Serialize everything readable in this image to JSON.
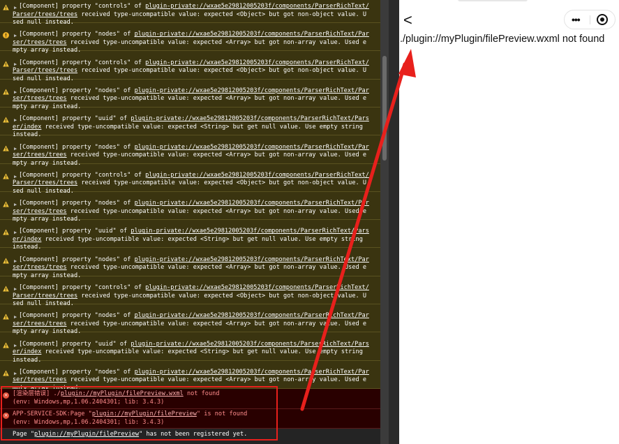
{
  "console": {
    "entries": [
      {
        "type": "warning",
        "first": "[Component] property \"controls\" of ",
        "link": "plugin-private://wxae5e29812005203f/components/ParserRichText/Parser/trees/trees",
        "rest": " received type-uncompatible value: expected <Object> but got non-object value. Used null instead."
      },
      {
        "type": "info",
        "first": "[Component] property \"nodes\" of ",
        "link": "plugin-private://wxae5e29812005203f/components/ParserRichText/Parser/trees/trees",
        "rest": " received type-uncompatible value: expected <Array> but got non-array value. Used empty array instead."
      },
      {
        "type": "warning",
        "first": "[Component] property \"controls\" of ",
        "link": "plugin-private://wxae5e29812005203f/components/ParserRichText/Parser/trees/trees",
        "rest": " received type-uncompatible value: expected <Object> but got non-object value. Used null instead."
      },
      {
        "type": "warning",
        "first": "[Component] property \"nodes\" of ",
        "link": "plugin-private://wxae5e29812005203f/components/ParserRichText/Parser/trees/trees",
        "rest": " received type-uncompatible value: expected <Array> but got non-array value. Used empty array instead."
      },
      {
        "type": "warning",
        "first": "[Component] property \"uuid\" of ",
        "link": "plugin-private://wxae5e29812005203f/components/ParserRichText/Parser/index",
        "rest": " received type-uncompatible value: expected <String> but get null value. Use empty string instead."
      },
      {
        "type": "warning",
        "first": "[Component] property \"nodes\" of ",
        "link": "plugin-private://wxae5e29812005203f/components/ParserRichText/Parser/trees/trees",
        "rest": " received type-uncompatible value: expected <Array> but got non-array value. Used empty array instead."
      },
      {
        "type": "warning",
        "first": "[Component] property \"controls\" of ",
        "link": "plugin-private://wxae5e29812005203f/components/ParserRichText/Parser/trees/trees",
        "rest": " received type-uncompatible value: expected <Object> but got non-object value. Used null instead."
      },
      {
        "type": "warning",
        "first": "[Component] property \"nodes\" of ",
        "link": "plugin-private://wxae5e29812005203f/components/ParserRichText/Parser/trees/trees",
        "rest": " received type-uncompatible value: expected <Array> but got non-array value. Used empty array instead."
      },
      {
        "type": "warning",
        "first": "[Component] property \"uuid\" of ",
        "link": "plugin-private://wxae5e29812005203f/components/ParserRichText/Parser/index",
        "rest": " received type-uncompatible value: expected <String> but get null value. Use empty string instead."
      },
      {
        "type": "warning",
        "first": "[Component] property \"nodes\" of ",
        "link": "plugin-private://wxae5e29812005203f/components/ParserRichText/Parser/trees/trees",
        "rest": " received type-uncompatible value: expected <Array> but got non-array value. Used empty array instead."
      },
      {
        "type": "warning",
        "first": "[Component] property \"controls\" of ",
        "link": "plugin-private://wxae5e29812005203f/components/ParserRichText/Parser/trees/trees",
        "rest": " received type-uncompatible value: expected <Object> but got non-object value. Used null instead."
      },
      {
        "type": "warning",
        "first": "[Component] property \"nodes\" of ",
        "link": "plugin-private://wxae5e29812005203f/components/ParserRichText/Parser/trees/trees",
        "rest": " received type-uncompatible value: expected <Array> but got non-array value. Used empty array instead."
      },
      {
        "type": "warning",
        "first": "[Component] property \"uuid\" of ",
        "link": "plugin-private://wxae5e29812005203f/components/ParserRichText/Parser/index",
        "rest": " received type-uncompatible value: expected <String> but get null value. Use empty string instead."
      },
      {
        "type": "warning",
        "first": "[Component] property \"nodes\" of ",
        "link": "plugin-private://wxae5e29812005203f/components/ParserRichText/Parser/trees/trees",
        "rest": " received type-uncompatible value: expected <Array> but got non-array value. Used empty array instead."
      }
    ],
    "errors": {
      "render_prefix": "[渲染层错误] ./",
      "render_link": "plugin://myPlugin/filePreview.wxml",
      "render_suffix": " not found",
      "render_env": "(env: Windows,mp,1.06.2404301; lib: 3.4.3)",
      "sdk_prefix": "APP-SERVICE-SDK:Page \"",
      "sdk_link": "plugin://myPlugin/filePreview",
      "sdk_suffix": "\" is not found",
      "sdk_env": "(env: Windows,mp,1.06.2404301; lib: 3.4.3)",
      "page_prefix": "Page \"",
      "page_link": "plugin://myPlugin/filePreview",
      "page_suffix": "\" has not been registered yet."
    }
  },
  "preview": {
    "back_glyph": "<",
    "menu_glyph": "•••",
    "not_found_text": "./plugin://myPlugin/filePreview.wxml not found"
  },
  "colors": {
    "warning_bg": "#3a3410",
    "error_bg": "#290000",
    "annotation_red": "#e8201c"
  }
}
